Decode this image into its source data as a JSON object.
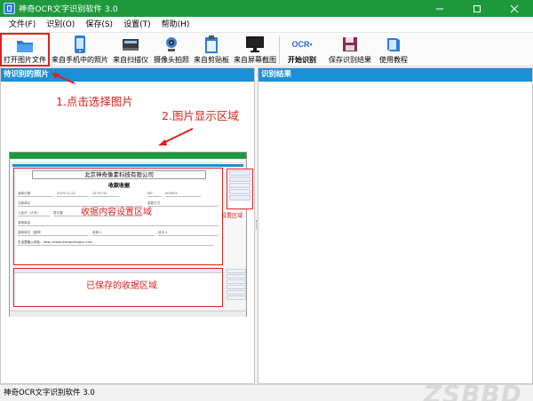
{
  "window": {
    "title": "神奇OCR文字识别软件 3.0",
    "controls": [
      "minimize",
      "maximize",
      "close"
    ]
  },
  "menu": [
    "文件(F)",
    "识别(O)",
    "保存(S)",
    "设置(T)",
    "帮助(H)"
  ],
  "toolbar": [
    {
      "label": "打开图片文件",
      "icon": "open-folder-icon"
    },
    {
      "label": "来自手机中的照片",
      "icon": "phone-icon"
    },
    {
      "label": "来自扫描仪",
      "icon": "scanner-icon"
    },
    {
      "label": "摄像头拍照",
      "icon": "webcam-icon"
    },
    {
      "label": "来自剪贴板",
      "icon": "clipboard-icon"
    },
    {
      "label": "来自屏幕截图",
      "icon": "monitor-icon"
    },
    {
      "label": "开始识别",
      "icon": "ocr-icon",
      "icon_text": "OCR"
    },
    {
      "label": "保存识别结果",
      "icon": "save-icon"
    },
    {
      "label": "使用教程",
      "icon": "book-icon"
    }
  ],
  "panels": {
    "left_title": "待识别的照片",
    "right_title": "识别结果"
  },
  "annotations": {
    "step1": "1.点击选择图片",
    "step2": "2.图片显示区域",
    "form_area": "收据内容设置区域",
    "settings_area": "设置区域",
    "saved_area": "已保存的收据区域"
  },
  "preview": {
    "company": "北京神奇像素科技有限公司",
    "doc_title": "收款收据",
    "fields": [
      "收款日期",
      "2019-11-22",
      "15:37:32",
      "NO",
      "000001",
      "交款单位",
      "收款方式",
      "人民币（大写）",
      "零元整",
      "收款事由",
      "收款单位（盖章）",
      "收款人",
      "经手人",
      "在这里输入网址：http://www.shenqixiangsu.com"
    ]
  },
  "statusbar": "神奇OCR文字识别软件 3.0",
  "watermark": "ZSBBD",
  "colors": {
    "title_bar": "#1e9a3d",
    "panel_header": "#1d8fd6",
    "annotation": "#e02020"
  }
}
